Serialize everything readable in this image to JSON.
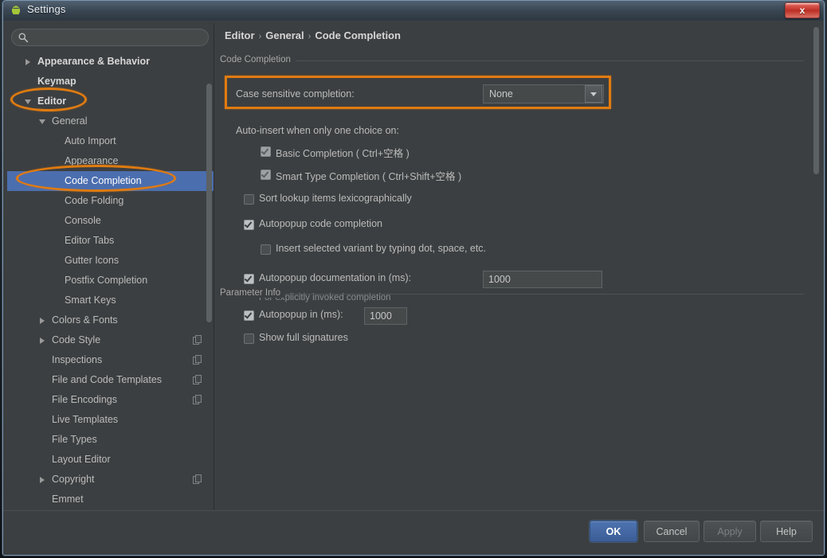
{
  "window": {
    "title": "Settings",
    "app_icon": "android-robot-icon",
    "close_label": "x"
  },
  "search": {
    "value": "",
    "placeholder": "",
    "icon": "search-icon"
  },
  "tree": {
    "items": [
      {
        "label": "Appearance & Behavior",
        "level": "top",
        "arrow": "right",
        "badge": false,
        "selected": false
      },
      {
        "label": "Keymap",
        "level": "top-noarrow",
        "arrow": "none",
        "badge": false,
        "selected": false
      },
      {
        "label": "Editor",
        "level": "top",
        "arrow": "down",
        "badge": false,
        "selected": false
      },
      {
        "label": "General",
        "level": "sub",
        "arrow": "down",
        "badge": false,
        "selected": false
      },
      {
        "label": "Auto Import",
        "level": "leaf",
        "arrow": "none",
        "badge": false,
        "selected": false
      },
      {
        "label": "Appearance",
        "level": "leaf",
        "arrow": "none",
        "badge": false,
        "selected": false
      },
      {
        "label": "Code Completion",
        "level": "leaf",
        "arrow": "none",
        "badge": false,
        "selected": true
      },
      {
        "label": "Code Folding",
        "level": "leaf",
        "arrow": "none",
        "badge": false,
        "selected": false
      },
      {
        "label": "Console",
        "level": "leaf",
        "arrow": "none",
        "badge": false,
        "selected": false
      },
      {
        "label": "Editor Tabs",
        "level": "leaf",
        "arrow": "none",
        "badge": false,
        "selected": false
      },
      {
        "label": "Gutter Icons",
        "level": "leaf",
        "arrow": "none",
        "badge": false,
        "selected": false
      },
      {
        "label": "Postfix Completion",
        "level": "leaf",
        "arrow": "none",
        "badge": false,
        "selected": false
      },
      {
        "label": "Smart Keys",
        "level": "leaf",
        "arrow": "none",
        "badge": false,
        "selected": false
      },
      {
        "label": "Colors & Fonts",
        "level": "sub",
        "arrow": "right",
        "badge": false,
        "selected": false
      },
      {
        "label": "Code Style",
        "level": "sub",
        "arrow": "right",
        "badge": true,
        "selected": false
      },
      {
        "label": "Inspections",
        "level": "sub",
        "arrow": "none",
        "badge": true,
        "selected": false
      },
      {
        "label": "File and Code Templates",
        "level": "sub",
        "arrow": "none",
        "badge": true,
        "selected": false
      },
      {
        "label": "File Encodings",
        "level": "sub",
        "arrow": "none",
        "badge": true,
        "selected": false
      },
      {
        "label": "Live Templates",
        "level": "sub",
        "arrow": "none",
        "badge": false,
        "selected": false
      },
      {
        "label": "File Types",
        "level": "sub",
        "arrow": "none",
        "badge": false,
        "selected": false
      },
      {
        "label": "Layout Editor",
        "level": "sub",
        "arrow": "none",
        "badge": false,
        "selected": false
      },
      {
        "label": "Copyright",
        "level": "sub",
        "arrow": "right",
        "badge": true,
        "selected": false
      },
      {
        "label": "Emmet",
        "level": "sub",
        "arrow": "none",
        "badge": false,
        "selected": false
      }
    ]
  },
  "breadcrumb": {
    "part1": "Editor",
    "sep1": "›",
    "part2": "General",
    "sep2": "›",
    "part3": "Code Completion"
  },
  "code_completion": {
    "group_title": "Code Completion",
    "case_sensitive_label": "Case sensitive completion:",
    "case_sensitive_value": "None",
    "combo_arrow_icon": "chevron-down-icon",
    "auto_insert_label": "Auto-insert when only one choice on:",
    "basic_completion_label": "Basic Completion ( Ctrl+空格 )",
    "smart_type_label": "Smart Type Completion ( Ctrl+Shift+空格 )",
    "sort_lookup_label": "Sort lookup items lexicographically",
    "autopopup_code_label": "Autopopup code completion",
    "insert_selected_label": "Insert selected variant by typing dot, space, etc.",
    "autopopup_doc_label": "Autopopup documentation in (ms):",
    "autopopup_doc_value": "1000",
    "autopopup_doc_hint": "For explicitly invoked completion"
  },
  "parameter_info": {
    "group_title": "Parameter Info",
    "autopopup_label": "Autopopup in (ms):",
    "autopopup_value": "1000",
    "show_full_signatures_label": "Show full signatures"
  },
  "footer": {
    "ok": "OK",
    "cancel": "Cancel",
    "apply": "Apply",
    "help": "Help"
  },
  "colors": {
    "accent_selection": "#4b6eaf",
    "annotation_orange": "#e07b10",
    "panel_bg": "#3c3f41",
    "text_primary": "#bbbbbb",
    "close_red": "#bb2f25"
  }
}
